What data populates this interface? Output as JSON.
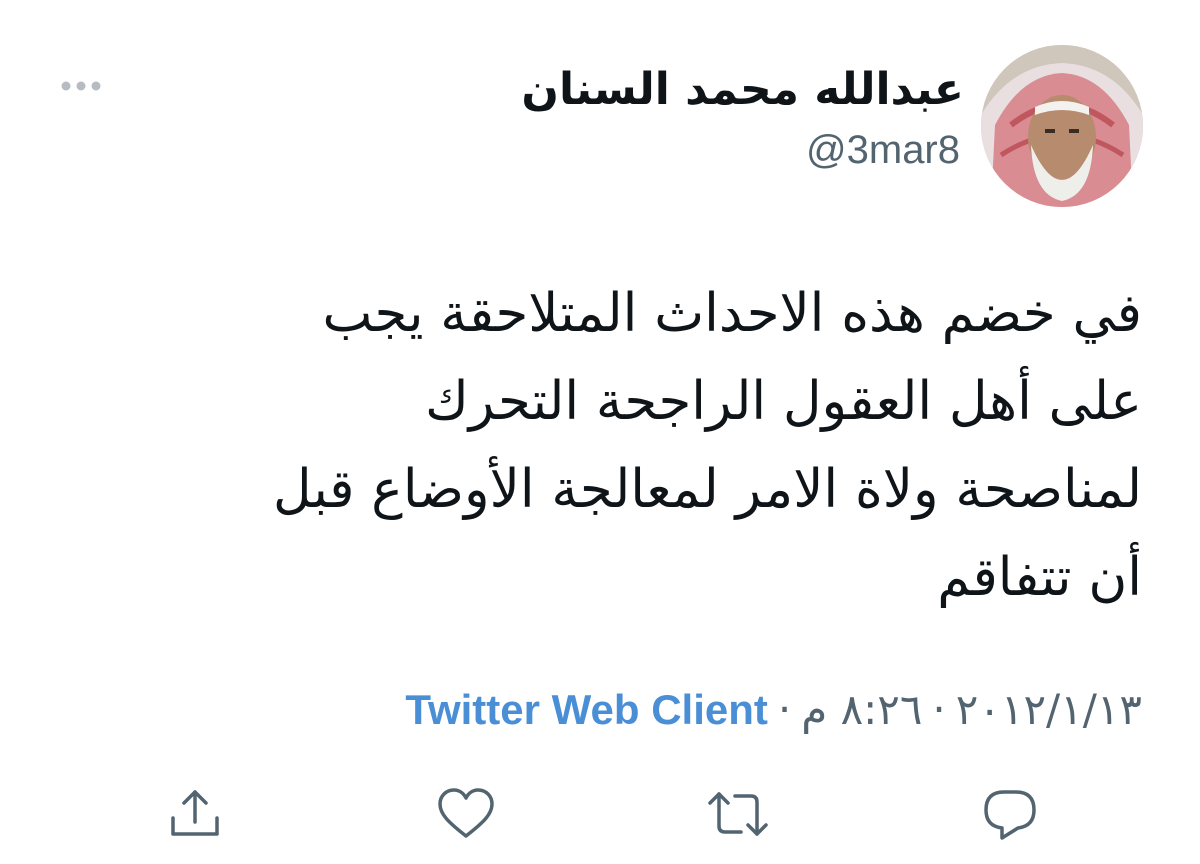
{
  "tweet": {
    "display_name": "عبدالله محمد السنان",
    "handle": "@3mar8",
    "text_lines": [
      "في خضم هذه الاحداث المتلاحقة يجب",
      "على أهل العقول الراجحة التحرك",
      "لمناصحة ولاة الامر لمعالجة الأوضاع قبل",
      "أن تتفاقم"
    ],
    "date": "٢٠١٢/١/١٣",
    "time": "٨:٢٦ م",
    "separator": "·",
    "source": "Twitter Web Client"
  },
  "icons": {
    "more": "more-dots-icon",
    "reply": "reply-bubble-icon",
    "retweet": "retweet-icon",
    "like": "heart-icon",
    "share": "share-upload-icon"
  },
  "colors": {
    "text": "#0f1419",
    "secondary": "#536471",
    "link": "#4a8fd6",
    "icon": "#536471"
  }
}
